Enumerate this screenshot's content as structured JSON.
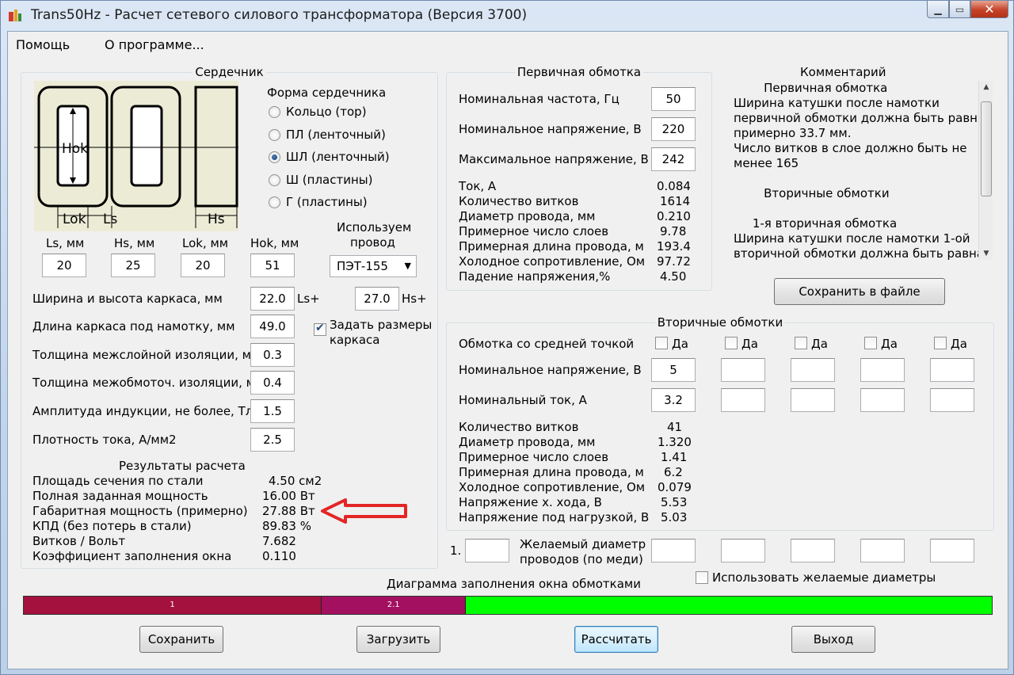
{
  "window": {
    "title": "Trans50Hz - Расчет сетевого силового трансформатора (Версия 3700)",
    "minimize_icon": "minimize-icon",
    "maximize_icon": "maximize-icon",
    "close_icon": "close-icon"
  },
  "menu": {
    "help": "Помощь",
    "about": "О программе..."
  },
  "core": {
    "legend": "Сердечник",
    "diagram_labels": {
      "hok": "Hok",
      "lok": "Lok",
      "ls": "Ls",
      "hs": "Hs"
    },
    "shape_title": "Форма сердечника",
    "shapes": [
      {
        "label": "Кольцо  (тор)",
        "selected": false
      },
      {
        "label": "ПЛ  (ленточный)",
        "selected": false
      },
      {
        "label": "ШЛ  (ленточный)",
        "selected": true
      },
      {
        "label": "Ш  (пластины)",
        "selected": false
      },
      {
        "label": "Г (пластины)",
        "selected": false
      }
    ],
    "dims": [
      {
        "label": "Ls, мм",
        "value": "20"
      },
      {
        "label": "Hs, мм",
        "value": "25"
      },
      {
        "label": "Lok, мм",
        "value": "20"
      },
      {
        "label": "Hok, мм",
        "value": "51"
      }
    ],
    "wire_title_1": "Используем",
    "wire_title_2": "провод",
    "wire_value": "ПЭТ-155",
    "frame_wh_label": "Ширина и высота каркаса, мм",
    "frame_w": "22.0",
    "frame_w_suffix": "Ls+",
    "frame_h": "27.0",
    "frame_h_suffix": "Hs+",
    "frame_len_label": "Длина каркаса под намотку, мм",
    "frame_len": "49.0",
    "set_frame_1": "Задать размеры",
    "set_frame_2": "каркаса",
    "set_frame_checked": true,
    "params": [
      {
        "label": "Толщина межслойной изоляции, мм",
        "value": "0.3"
      },
      {
        "label": "Толщина межобмоточ. изоляции, мм",
        "value": "0.4"
      },
      {
        "label": "Амплитуда индукции, не более, Тл",
        "value": "1.5"
      },
      {
        "label": "Плотность тока, А/мм2",
        "value": "2.5"
      }
    ],
    "results_title": "Результаты расчета",
    "results": [
      {
        "label": "Площадь сечения по стали",
        "value": "4.50 см2"
      },
      {
        "label": "Полная заданная мощность",
        "value": "16.00 Вт"
      },
      {
        "label": "Габаритная мощность (примерно)",
        "value": "27.88 Вт"
      },
      {
        "label": "КПД (без потерь в стали)",
        "value": "89.83 %"
      },
      {
        "label": "Витков / Вольт",
        "value": "7.682"
      },
      {
        "label": "Коэффициент заполнения окна",
        "value": "0.110"
      }
    ]
  },
  "primary": {
    "legend": "Первичная обмотка",
    "inputs": [
      {
        "label": "Номинальная частота, Гц",
        "value": "50"
      },
      {
        "label": "Номинальное напряжение, В",
        "value": "220"
      },
      {
        "label": "Максимальное напряжение, В",
        "value": "242"
      }
    ],
    "results": [
      {
        "label": "Ток, А",
        "value": "0.084"
      },
      {
        "label": "Количество витков",
        "value": "1614"
      },
      {
        "label": "Диаметр провода, мм",
        "value": "0.210"
      },
      {
        "label": "Примерное число слоев",
        "value": "9.78"
      },
      {
        "label": "Примерная длина провода, м",
        "value": "193.4"
      },
      {
        "label": "Холодное сопротивление, Ом",
        "value": "97.72"
      },
      {
        "label": "Падение напряжения,%",
        "value": "4.50"
      }
    ]
  },
  "comment": {
    "title": "Комментарий",
    "lines": [
      "        Первичная обмотка",
      "Ширина катушки после намотки",
      "первичной обмотки должна быть равна",
      "примерно 33.7 мм.",
      "Число витков в слое должно быть не",
      "менее 165",
      "",
      "        Вторичные обмотки",
      "",
      "     1-я вторичная обмотка",
      "Ширина катушки после намотки 1-ой",
      "вторичной обмотки должна быть равна"
    ],
    "save_button": "Сохранить в файле"
  },
  "secondary": {
    "legend": "Вторичные обмотки",
    "center_tap_label": "Обмотка со средней точкой",
    "yes_label": "Да",
    "voltage_label": "Номинальное напряжение, В",
    "current_label": "Номинальный ток, А",
    "voltages": [
      "5",
      "",
      "",
      "",
      ""
    ],
    "currents": [
      "3.2",
      "",
      "",
      "",
      ""
    ],
    "results": [
      {
        "label": "Количество витков",
        "value": "41"
      },
      {
        "label": "Диаметр провода, мм",
        "value": "1.320"
      },
      {
        "label": "Примерное число слоев",
        "value": "1.41"
      },
      {
        "label": "Примерная длина провода, м",
        "value": "6.2"
      },
      {
        "label": "Холодное сопротивление, Ом",
        "value": "0.079"
      },
      {
        "label": "Напряжение х. хода, В",
        "value": "5.53"
      },
      {
        "label": "Напряжение под нагрузкой, В",
        "value": "5.03"
      }
    ]
  },
  "desired": {
    "index_label": "1.",
    "label_1": "Желаемый диаметр",
    "label_2": "проводов  (по меди)",
    "use_label": "Использовать желаемые диаметры"
  },
  "fill_diagram": {
    "title": "Диаграмма заполнения окна обмотками",
    "segments": [
      {
        "label": "1",
        "fraction": 0.307,
        "color": "#a4113e"
      },
      {
        "label": "2.1",
        "fraction": 0.149,
        "color": "#a3105f"
      },
      {
        "label": "",
        "fraction": 0.544,
        "color": "#00ff00"
      }
    ]
  },
  "buttons": {
    "save": "Сохранить",
    "load": "Загрузить",
    "calc": "Рассчитать",
    "exit": "Выход"
  },
  "annotation": {
    "arrow_color": "#e32526"
  }
}
